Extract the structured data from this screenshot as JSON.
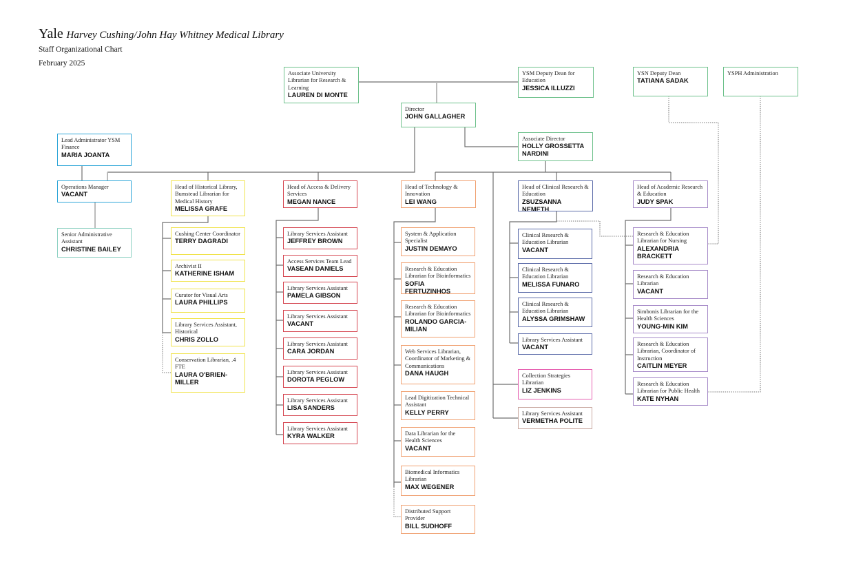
{
  "header": {
    "brand": "Yale",
    "library": "Harvey Cushing/John Hay Whitney Medical Library",
    "subtitle": "Staff Organizational Chart",
    "date": "February 2025"
  },
  "colors": {
    "leadership": "#6cc08a",
    "administration": "#2ea6d8",
    "admin_support": "#8fd1c3",
    "historical": "#f0e34a",
    "access_delivery": "#d4434e",
    "technology": "#f0a070",
    "clinical": "#5a6aa8",
    "academic": "#a68ac8",
    "collections": "#e65fb0",
    "collections_support": "#c9a8a0",
    "connector": "#6f6f6f"
  },
  "nodes": {
    "aul": {
      "role": "Associate University Librarian for Research & Learning",
      "name": "LAUREN DI MONTE"
    },
    "ysm_dean": {
      "role": "YSM Deputy Dean for Education",
      "name": "JESSICA ILLUZZI"
    },
    "ysn_dean": {
      "role": "YSN Deputy Dean",
      "name": "TATIANA SADAK"
    },
    "ysph": {
      "role": "YSPH Administration",
      "name": ""
    },
    "director": {
      "role": "Director",
      "name": "JOHN GALLAGHER"
    },
    "assoc_dir": {
      "role": "Associate Director",
      "name": "HOLLY GROSSETTA NARDINI"
    },
    "lead_admin": {
      "role": "Lead Administrator YSM Finance",
      "name": "MARIA JOANTA"
    },
    "ops_mgr": {
      "role": "Operations Manager",
      "name": "VACANT"
    },
    "sr_admin": {
      "role": "Senior Administrative Assistant",
      "name": "CHRISTINE BAILEY"
    },
    "hist_head": {
      "role": "Head of Historical Library, Bumstead Librarian for Medical History",
      "name": "MELISSA GRAFE"
    },
    "access_head": {
      "role": "Head of Access & Delivery Services",
      "name": "MEGAN NANCE"
    },
    "tech_head": {
      "role": "Head of Technology & Innovation",
      "name": "LEI WANG"
    },
    "clin_head": {
      "role": "Head of Clinical Research & Education",
      "name": "ZSUZSANNA NEMETH"
    },
    "acad_head": {
      "role": "Head of Academic Research & Education",
      "name": "JUDY SPAK"
    }
  },
  "historical_staff": [
    {
      "role": "Cushing Center Coordinator",
      "name": "TERRY DAGRADI"
    },
    {
      "role": "Archivist II",
      "name": "KATHERINE ISHAM"
    },
    {
      "role": "Curator for Visual Arts",
      "name": "LAURA PHILLIPS"
    },
    {
      "role": "Library Services Assistant, Historical",
      "name": "CHRIS ZOLLO"
    },
    {
      "role": "Conservation Librarian, .4 FTE",
      "name": "LAURA O'BRIEN-MILLER"
    }
  ],
  "access_staff": [
    {
      "role": "Library Services Assistant",
      "name": "JEFFREY BROWN"
    },
    {
      "role": "Access Services Team Lead",
      "name": "VASEAN DANIELS"
    },
    {
      "role": "Library Services Assistant",
      "name": "PAMELA GIBSON"
    },
    {
      "role": "Library Services Assistant",
      "name": "VACANT"
    },
    {
      "role": "Library Services Assistant",
      "name": "CARA JORDAN"
    },
    {
      "role": "Library Services Assistant",
      "name": "DOROTA PEGLOW"
    },
    {
      "role": "Library Services Assistant",
      "name": "LISA SANDERS"
    },
    {
      "role": "Library Services Assistant",
      "name": "KYRA WALKER"
    }
  ],
  "tech_staff": [
    {
      "role": "System & Application Specialist",
      "name": "JUSTIN DEMAYO"
    },
    {
      "role": "Research & Education Librarian for Bioinformatics",
      "name": "SOFIA FERTUZINHOS"
    },
    {
      "role": "Research & Education Librarian for Bioinformatics",
      "name": "ROLANDO GARCIA-MILIAN"
    },
    {
      "role": "Web Services Librarian, Coordinator of Marketing & Communications",
      "name": "DANA HAUGH"
    },
    {
      "role": "Lead Digitization Technical Assistant",
      "name": "KELLY PERRY"
    },
    {
      "role": "Data Librarian for the Health Sciences",
      "name": "VACANT"
    },
    {
      "role": "Biomedical Informatics Librarian",
      "name": "MAX WEGENER"
    },
    {
      "role": "Distributed Support Provider",
      "name": "BILL SUDHOFF"
    }
  ],
  "clinical_staff": [
    {
      "role": "Clinical Research & Education Librarian",
      "name": "VACANT"
    },
    {
      "role": "Clinical Research & Education Librarian",
      "name": "MELISSA FUNARO"
    },
    {
      "role": "Clinical Research & Education Librarian",
      "name": "ALYSSA GRIMSHAW"
    },
    {
      "role": "Library Services Assistant",
      "name": "VACANT"
    }
  ],
  "collections_staff": [
    {
      "role": "Collection Strategies Librarian",
      "name": "LIZ JENKINS"
    },
    {
      "role": "Library Services Assistant",
      "name": "VERMETHA POLITE"
    }
  ],
  "academic_staff": [
    {
      "role": "Research & Education Librarian for Nursing",
      "name": "ALEXANDRIA BRACKETT"
    },
    {
      "role": "Research & Education Librarian",
      "name": "VACANT"
    },
    {
      "role": "Simbonis Librarian for the Health Sciences",
      "name": "YOUNG-MIN KIM"
    },
    {
      "role": "Research & Education Librarian, Coordinator of Instruction",
      "name": "CAITLIN MEYER"
    },
    {
      "role": "Research & Education Librarian for Public Health",
      "name": "KATE NYHAN"
    }
  ]
}
